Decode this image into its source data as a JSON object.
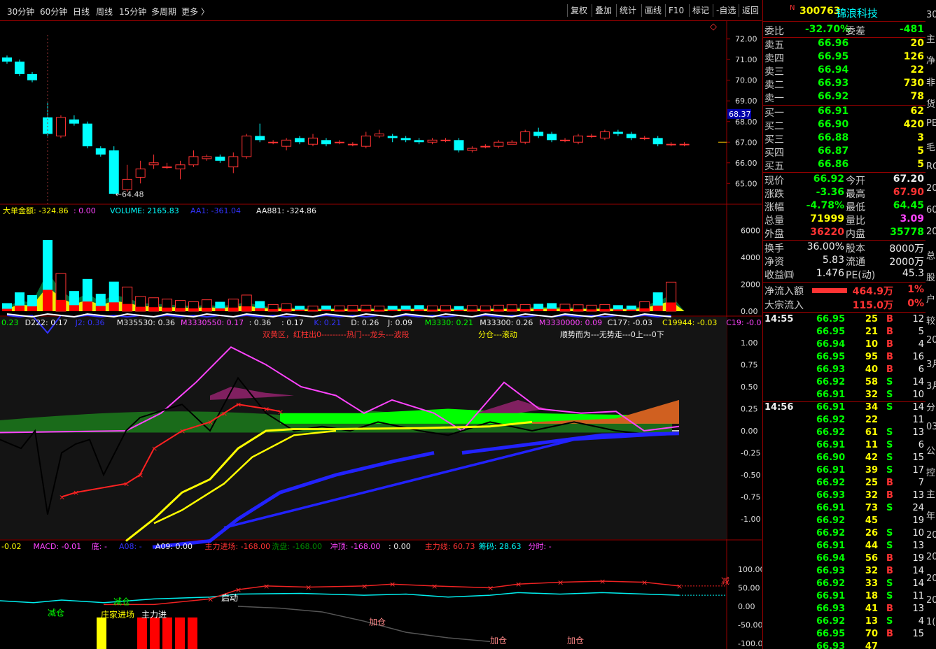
{
  "toolbar": {
    "periods": [
      "30分钟",
      "60分钟",
      "日线",
      "周线",
      "15分钟",
      "多周期",
      "更多 〉"
    ],
    "buttons": [
      "复权",
      "叠加",
      "统计",
      "画线",
      "F10",
      "标记",
      "-自选",
      "返回"
    ],
    "diamond": "◇"
  },
  "stock": {
    "badge": "N",
    "code": "300763",
    "name": "锦浪科技"
  },
  "bid_ask": {
    "weibi_label": "委比",
    "weibi": "-32.70%",
    "weicha_label": "委差",
    "weicha": "-481",
    "sells": [
      {
        "l": "卖五",
        "p": "66.96",
        "v": "20"
      },
      {
        "l": "卖四",
        "p": "66.95",
        "v": "126"
      },
      {
        "l": "卖三",
        "p": "66.94",
        "v": "22"
      },
      {
        "l": "卖二",
        "p": "66.93",
        "v": "730"
      },
      {
        "l": "卖一",
        "p": "66.92",
        "v": "78"
      }
    ],
    "buys": [
      {
        "l": "买一",
        "p": "66.91",
        "v": "62"
      },
      {
        "l": "买二",
        "p": "66.90",
        "v": "420"
      },
      {
        "l": "买三",
        "p": "66.88",
        "v": "3"
      },
      {
        "l": "买四",
        "p": "66.87",
        "v": "5"
      },
      {
        "l": "买五",
        "p": "66.86",
        "v": "5"
      }
    ]
  },
  "quote": [
    {
      "l1": "现价",
      "v1": "66.92",
      "l2": "今开",
      "v2": "67.20"
    },
    {
      "l1": "涨跌",
      "v1": "-3.36",
      "l2": "最高",
      "v2": "67.90"
    },
    {
      "l1": "涨幅",
      "v1": "-4.78%",
      "l2": "最低",
      "v2": "64.45"
    },
    {
      "l1": "总量",
      "v1": "71999",
      "l2": "量比",
      "v2": "3.09"
    },
    {
      "l1": "外盘",
      "v1": "36220",
      "l2": "内盘",
      "v2": "35778"
    }
  ],
  "finance": [
    {
      "l1": "换手",
      "v1": "36.00%",
      "l2": "股本",
      "v2": "8000万"
    },
    {
      "l1": "净资",
      "v1": "5.83",
      "l2": "流通",
      "v2": "2000万"
    },
    {
      "l1": "收益㈣",
      "v1": "1.476",
      "l2": "PE(动)",
      "v2": "45.3"
    }
  ],
  "flows": [
    {
      "l": "净流入额",
      "v": "464.9万",
      "p": "1%",
      "bar": 0.5
    },
    {
      "l": "大宗流入",
      "v": "115.0万",
      "p": "0%",
      "bar": 0
    }
  ],
  "ticks1": {
    "time": "14:55",
    "rows": [
      [
        "66.95",
        "25",
        "B",
        "12"
      ],
      [
        "66.95",
        "21",
        "B",
        "5"
      ],
      [
        "66.94",
        "10",
        "B",
        "4"
      ],
      [
        "66.95",
        "95",
        "B",
        "16"
      ],
      [
        "66.93",
        "40",
        "B",
        "6"
      ],
      [
        "66.92",
        "58",
        "S",
        "14"
      ],
      [
        "66.91",
        "32",
        "S",
        "10"
      ]
    ]
  },
  "ticks2": {
    "time": "14:56",
    "rows": [
      [
        "66.91",
        "34",
        "S",
        "14"
      ],
      [
        "66.92",
        "22",
        "",
        "11"
      ],
      [
        "66.92",
        "61",
        "S",
        "13"
      ],
      [
        "66.91",
        "11",
        "S",
        "6"
      ],
      [
        "66.90",
        "42",
        "S",
        "15"
      ],
      [
        "66.91",
        "39",
        "S",
        "17"
      ],
      [
        "66.92",
        "25",
        "B",
        "7"
      ],
      [
        "66.93",
        "32",
        "B",
        "13"
      ],
      [
        "66.91",
        "73",
        "S",
        "24"
      ],
      [
        "66.92",
        "45",
        "",
        "19"
      ],
      [
        "66.92",
        "26",
        "S",
        "10"
      ],
      [
        "66.91",
        "44",
        "S",
        "13"
      ],
      [
        "66.94",
        "56",
        "B",
        "19"
      ],
      [
        "66.93",
        "32",
        "B",
        "14"
      ],
      [
        "66.92",
        "33",
        "S",
        "14"
      ],
      [
        "66.91",
        "18",
        "S",
        "11"
      ],
      [
        "66.93",
        "41",
        "B",
        "13"
      ],
      [
        "66.92",
        "13",
        "S",
        "4"
      ],
      [
        "66.95",
        "70",
        "B",
        "15"
      ],
      [
        "66.93",
        "47",
        "",
        ""
      ]
    ]
  },
  "edge_chars": [
    "30",
    "主",
    "净",
    "非",
    "货",
    "PE",
    "毛",
    "RO",
    "20",
    "60",
    "20",
    "总",
    "股",
    "户",
    "较",
    "20",
    "3月",
    "3月",
    "分",
    "03",
    "公",
    "控",
    "主",
    "年",
    "20",
    "20",
    "20",
    "20",
    "1("
  ],
  "panels": {
    "main": {
      "ylabels": [
        "72.00",
        "71.00",
        "70.00",
        "69.00",
        "68.00",
        "67.00",
        "66.00",
        "65.00"
      ],
      "current": "68.37",
      "low_label": "←64.48"
    },
    "vol": {
      "legend": [
        {
          "t": "大单金额: -324.86",
          "c": "#ff0"
        },
        {
          "t": ": 0.00",
          "c": "#f4f"
        },
        {
          "t": "VOLUME: 2165.83",
          "c": "#0ff"
        },
        {
          "t": "AA1: -361.04",
          "c": "#33f"
        },
        {
          "t": "AA881: -324.86",
          "c": "#eee"
        }
      ],
      "ylabels": [
        "6000",
        "4000",
        "2000",
        "0.00"
      ]
    },
    "ind": {
      "legend": [
        {
          "t": "0.23",
          "c": "#0f0"
        },
        {
          "t": "D222: 0.17",
          "c": "#eee"
        },
        {
          "t": "J2: 0.36",
          "c": "#33f"
        },
        {
          "t": "M335530: 0.36",
          "c": "#eee"
        },
        {
          "t": "M3330550: 0.17",
          "c": "#f4f"
        },
        {
          "t": ": 0.36",
          "c": "#eee"
        },
        {
          "t": ": 0.17",
          "c": "#eee"
        },
        {
          "t": "K: 0.21",
          "c": "#33f"
        },
        {
          "t": "D: 0.26",
          "c": "#eee"
        },
        {
          "t": "J: 0.09",
          "c": "#eee"
        },
        {
          "t": "M3330: 0.21",
          "c": "#0f0"
        },
        {
          "t": "M33300: 0.26",
          "c": "#eee"
        },
        {
          "t": "M3330000: 0.09",
          "c": "#f4f"
        },
        {
          "t": "C177: -0.03",
          "c": "#eee"
        },
        {
          "t": "C19944: -0.03",
          "c": "#ff0"
        },
        {
          "t": "C19: -0.04",
          "c": "#f4f"
        },
        {
          "t": ": -0.04",
          "c": "#33f"
        }
      ],
      "annotations": [
        {
          "t": "双黄区，红柱出0---------热门---龙头---波段",
          "c": "#f33"
        },
        {
          "t": "分仓---滚动",
          "c": "#ff0"
        },
        {
          "t": "顺势而为---无势走---0上---0下",
          "c": "#eee"
        }
      ],
      "ylabels": [
        "1.00",
        "0.75",
        "0.50",
        "0.25",
        "0.00",
        "-0.25",
        "-0.50",
        "-0.75",
        "-1.00"
      ]
    },
    "macd": {
      "legend": [
        {
          "t": "-0.02",
          "c": "#ff0"
        },
        {
          "t": "MACD: -0.01",
          "c": "#f4f"
        },
        {
          "t": "底: -",
          "c": "#f4f"
        },
        {
          "t": "A08: -",
          "c": "#33f"
        },
        {
          "t": "A09: 0.00",
          "c": "#eee"
        },
        {
          "t": "主力进场: -168.00",
          "c": "#f33"
        },
        {
          "t": "洗盘: -168.00",
          "c": "#080"
        },
        {
          "t": "冲顶: -168.00",
          "c": "#f4f"
        },
        {
          "t": ": 0.00",
          "c": "#eee"
        },
        {
          "t": "主力线: 60.73",
          "c": "#f33"
        },
        {
          "t": "筹码: 28.63",
          "c": "#0ff"
        },
        {
          "t": "分时: -",
          "c": "#f4f"
        }
      ],
      "labels": [
        {
          "t": "减仓",
          "c": "#0f0"
        },
        {
          "t": "减仓",
          "c": "#0f0"
        },
        {
          "t": "庄家进场",
          "c": "#ff0"
        },
        {
          "t": "主力进",
          "c": "#fff"
        },
        {
          "t": "启动",
          "c": "#fff"
        },
        {
          "t": "加仓",
          "c": "#f88"
        },
        {
          "t": "加仓",
          "c": "#f88"
        },
        {
          "t": "加仓",
          "c": "#f88"
        },
        {
          "t": "减",
          "c": "#f33"
        }
      ],
      "ylabels": [
        "100.00",
        "50.00",
        "0.00",
        "-50.00",
        "-100.00"
      ]
    }
  },
  "chart_data": {
    "type": "candlestick",
    "candles": [
      [
        71.1,
        70.9,
        71.2,
        70.8
      ],
      [
        70.9,
        70.3,
        71.0,
        70.2
      ],
      [
        70.3,
        70.0,
        70.4,
        69.9
      ],
      [
        68.2,
        67.4,
        68.9,
        67.3
      ],
      [
        67.3,
        68.2,
        68.3,
        67.2
      ],
      [
        68.1,
        67.9,
        68.3,
        67.8
      ],
      [
        67.9,
        66.8,
        68.0,
        66.7
      ],
      [
        66.7,
        66.4,
        66.8,
        66.3
      ],
      [
        66.6,
        64.5,
        66.8,
        64.48
      ],
      [
        64.7,
        65.2,
        65.9,
        64.6
      ],
      [
        65.3,
        65.7,
        66.1,
        65.0
      ],
      [
        65.9,
        66.0,
        66.4,
        65.7
      ],
      [
        65.8,
        65.8,
        66.0,
        65.7
      ],
      [
        65.7,
        65.9,
        66.1,
        65.2
      ],
      [
        65.9,
        66.3,
        66.6,
        65.8
      ],
      [
        66.2,
        66.3,
        66.4,
        66.1
      ],
      [
        66.3,
        66.1,
        66.4,
        66.0
      ],
      [
        65.8,
        66.3,
        66.5,
        65.5
      ],
      [
        66.3,
        67.3,
        67.4,
        66.2
      ],
      [
        67.3,
        67.1,
        67.9,
        67.0
      ],
      [
        67.0,
        67.0,
        67.1,
        66.9
      ],
      [
        66.8,
        67.1,
        67.2,
        66.6
      ],
      [
        67.2,
        67.0,
        67.3,
        66.9
      ],
      [
        66.9,
        67.2,
        67.4,
        66.8
      ],
      [
        67.1,
        66.9,
        67.2,
        66.8
      ],
      [
        67.0,
        67.0,
        67.1,
        66.9
      ],
      [
        66.9,
        66.9,
        67.0,
        66.8
      ],
      [
        66.8,
        67.3,
        67.5,
        66.7
      ],
      [
        67.3,
        67.4,
        67.6,
        67.2
      ],
      [
        67.3,
        67.2,
        67.4,
        67.0
      ],
      [
        67.2,
        67.1,
        67.3,
        67.0
      ],
      [
        67.1,
        67.0,
        67.2,
        66.9
      ],
      [
        67.0,
        67.1,
        67.2,
        66.9
      ],
      [
        67.1,
        67.1,
        67.2,
        67.0
      ],
      [
        67.1,
        66.6,
        67.2,
        66.5
      ],
      [
        66.6,
        66.7,
        66.8,
        66.5
      ],
      [
        66.8,
        66.8,
        66.9,
        66.7
      ],
      [
        66.8,
        67.0,
        67.1,
        66.7
      ],
      [
        66.9,
        67.0,
        67.1,
        66.9
      ],
      [
        67.0,
        67.5,
        67.6,
        66.9
      ],
      [
        67.5,
        67.3,
        67.7,
        67.2
      ],
      [
        67.4,
        67.1,
        67.5,
        67.0
      ],
      [
        67.1,
        67.1,
        67.2,
        67.0
      ],
      [
        67.0,
        67.3,
        67.4,
        66.9
      ],
      [
        67.3,
        67.3,
        67.4,
        67.2
      ],
      [
        67.2,
        67.5,
        67.6,
        67.1
      ],
      [
        67.5,
        67.4,
        67.6,
        67.3
      ],
      [
        67.4,
        67.2,
        67.5,
        67.1
      ],
      [
        67.2,
        67.2,
        67.3,
        67.1
      ],
      [
        67.2,
        66.9,
        67.3,
        66.8
      ],
      [
        66.9,
        66.9,
        67.0,
        66.8
      ],
      [
        66.9,
        66.9,
        67.0,
        66.8
      ]
    ],
    "volume": [
      600,
      1400,
      1200,
      5300,
      2800,
      1500,
      2400,
      1300,
      2200,
      1800,
      1100,
      1000,
      900,
      800,
      700,
      850,
      700,
      900,
      1200,
      750,
      500,
      550,
      400,
      380,
      420,
      400,
      430,
      450,
      380,
      400,
      420,
      450,
      400,
      420,
      380,
      420,
      400,
      450,
      480,
      500,
      550,
      600,
      520,
      480,
      450,
      500,
      450,
      420,
      700,
      1400,
      2165
    ],
    "ylim": [
      64.4,
      72.6
    ]
  }
}
